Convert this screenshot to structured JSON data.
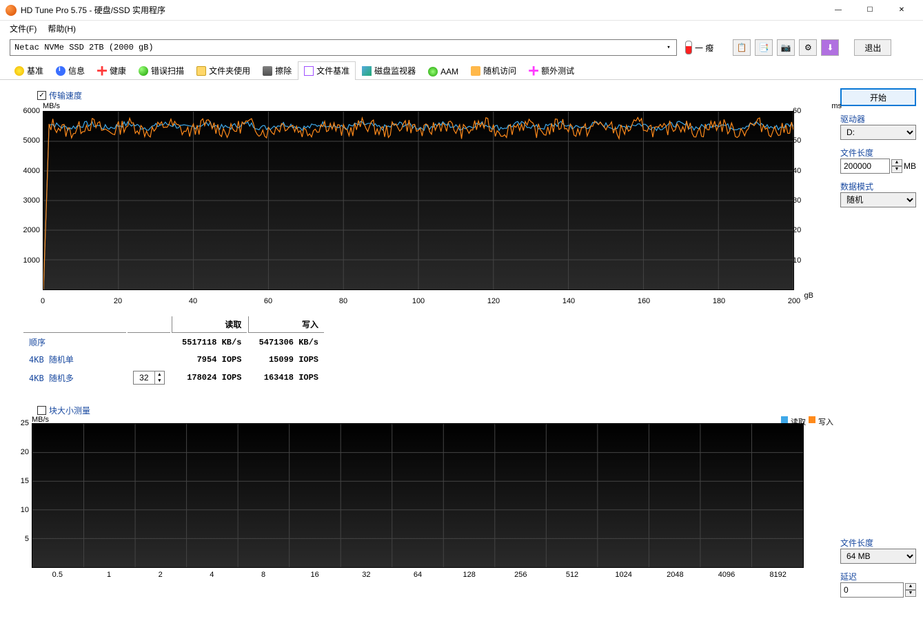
{
  "window": {
    "title": "HD Tune Pro 5.75 - 硬盘/SSD 实用程序"
  },
  "winbtns": {
    "min": "—",
    "max": "☐",
    "close": "✕"
  },
  "menu": {
    "file": "文件(F)",
    "help": "帮助(H)"
  },
  "drive": "Netac NVMe SSD 2TB (2000 gB)",
  "temp_text": "一 癈",
  "exit": "退出",
  "tabs": {
    "benchmark": "基准",
    "info": "信息",
    "health": "健康",
    "scan": "错误扫描",
    "folder": "文件夹使用",
    "erase": "擦除",
    "filebench": "文件基准",
    "monitor": "磁盘监视器",
    "aam": "AAM",
    "random": "随机访问",
    "extra": "额外测试"
  },
  "transfer": {
    "checkbox_label": "传输速度",
    "y_unit": "MB/s",
    "y_ticks": [
      "6000",
      "5000",
      "4000",
      "3000",
      "2000",
      "1000"
    ],
    "right_unit": "ms",
    "right_ticks": [
      "60",
      "50",
      "40",
      "30",
      "20",
      "10"
    ],
    "x_ticks": [
      "0",
      "20",
      "40",
      "60",
      "80",
      "100",
      "120",
      "140",
      "160",
      "180",
      "200"
    ],
    "x_unit": "gB"
  },
  "results": {
    "headers": {
      "read": "读取",
      "write": "写入"
    },
    "rows": [
      {
        "label": "顺序",
        "read": "5517118 KB/s",
        "write": "5471306 KB/s"
      },
      {
        "label": "4KB 随机单",
        "read": "7954 IOPS",
        "write": "15099 IOPS"
      },
      {
        "label": "4KB 随机多",
        "read": "178024 IOPS",
        "write": "163418 IOPS"
      }
    ],
    "multi_queue": "32"
  },
  "blocksize": {
    "checkbox_label": "块大小测量",
    "y_unit": "MB/s",
    "y_ticks": [
      "25",
      "20",
      "15",
      "10",
      "5"
    ],
    "x_ticks": [
      "0.5",
      "1",
      "2",
      "4",
      "8",
      "16",
      "32",
      "64",
      "128",
      "256",
      "512",
      "1024",
      "2048",
      "4096",
      "8192"
    ],
    "legend": {
      "read": "读取",
      "write": "写入"
    }
  },
  "side": {
    "start": "开始",
    "drive_label": "驱动器",
    "drive_value": "D:",
    "filelen_label": "文件长度",
    "filelen_value": "200000",
    "filelen_unit": "MB",
    "pattern_label": "数据模式",
    "pattern_value": "随机",
    "filelen2_label": "文件长度",
    "filelen2_value": "64 MB",
    "delay_label": "延迟",
    "delay_value": "0"
  },
  "chart_data": {
    "top_chart": {
      "type": "line",
      "x_range_gb": [
        0,
        200
      ],
      "y_range_mbs": [
        0,
        6000
      ],
      "y2_range_ms": [
        0,
        60
      ],
      "series": [
        {
          "name": "读取",
          "color": "#3fa8e8",
          "approx_mean_mbs": 5500,
          "approx_range_mbs": [
            5300,
            5700
          ]
        },
        {
          "name": "写入",
          "color": "#ff8a1a",
          "approx_mean_mbs": 5450,
          "approx_range_mbs": [
            4900,
            5750
          ]
        }
      ],
      "note": "dense noisy traces near ~5500 MB/s with an initial ramp at x≈0"
    },
    "bottom_chart": {
      "type": "bar",
      "x_categories_kb": [
        0.5,
        1,
        2,
        4,
        8,
        16,
        32,
        64,
        128,
        256,
        512,
        1024,
        2048,
        4096,
        8192
      ],
      "y_range_mbs": [
        0,
        25
      ],
      "series": [
        {
          "name": "读取",
          "color": "#3fa8e8",
          "values": []
        },
        {
          "name": "写入",
          "color": "#ff8a1a",
          "values": []
        }
      ],
      "note": "empty (test not run)"
    }
  }
}
